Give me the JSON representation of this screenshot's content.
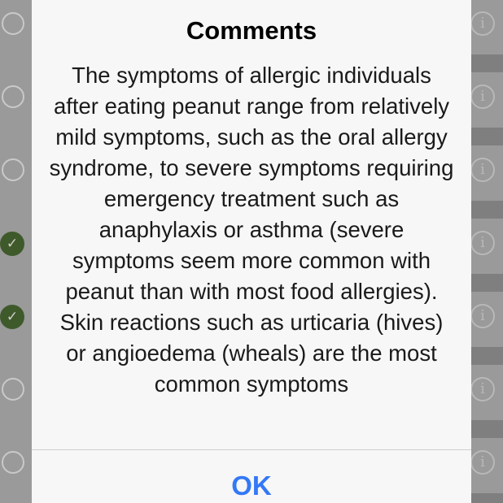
{
  "rows": [
    {
      "state": "unchecked"
    },
    {
      "state": "unchecked"
    },
    {
      "state": "unchecked"
    },
    {
      "state": "checked"
    },
    {
      "state": "checked"
    },
    {
      "state": "unchecked"
    },
    {
      "state": "unchecked"
    }
  ],
  "icons": {
    "info": "i",
    "check": "✓"
  },
  "alert": {
    "title": "Comments",
    "message": "The symptoms of allergic individuals after eating peanut range from relatively mild symptoms, such as the oral allergy syndrome, to severe symptoms requiring emergency treatment such as anaphylaxis or asthma (severe symptoms seem more common with peanut than with most food allergies). Skin reactions such as urticaria (hives) or angioedema (wheals) are the most common symptoms",
    "ok_label": "OK"
  },
  "colors": {
    "accent": "#3478f6",
    "check_fill": "#3f5a2a"
  }
}
